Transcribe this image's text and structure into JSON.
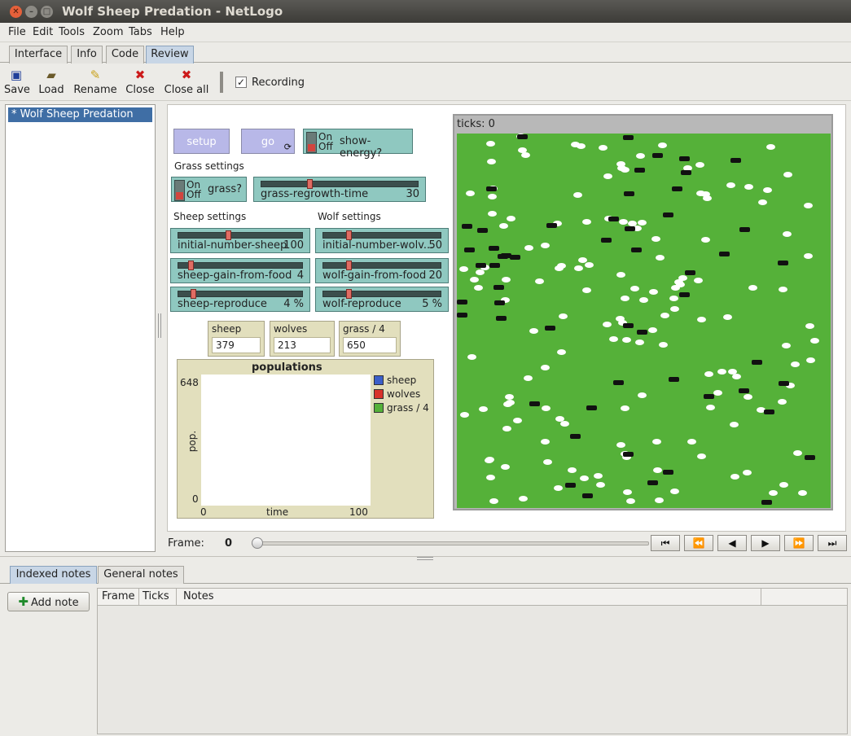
{
  "window": {
    "title": "Wolf Sheep Predation - NetLogo"
  },
  "menu": [
    "File",
    "Edit",
    "Tools",
    "Zoom",
    "Tabs",
    "Help"
  ],
  "tabs": [
    "Interface",
    "Info",
    "Code",
    "Review"
  ],
  "toolbar": {
    "save": "Save",
    "load": "Load",
    "rename": "Rename",
    "close": "Close",
    "close_all": "Close all",
    "recording_label": "Recording",
    "recording_checked": true
  },
  "runs": {
    "items": [
      "* Wolf Sheep Predation"
    ]
  },
  "interface": {
    "setup_button": "setup",
    "go_button": "go",
    "show_energy": {
      "on": "On",
      "off": "Off",
      "label": "show-energy?"
    },
    "grass_settings_note": "Grass settings",
    "grass_switch": {
      "on": "On",
      "off": "Off",
      "label": "grass?"
    },
    "grass_regrowth": {
      "label": "grass-regrowth-time",
      "value": "30",
      "fraction": 0.3
    },
    "sheep_settings_note": "Sheep settings",
    "wolf_settings_note": "Wolf settings",
    "initial_sheep": {
      "label": "initial-number-sheep",
      "value": "100",
      "fraction": 0.4
    },
    "initial_wolves": {
      "label": "initial-number-wolv...",
      "value": "50",
      "fraction": 0.2
    },
    "sheep_gain": {
      "label": "sheep-gain-from-food",
      "value": "4",
      "fraction": 0.08
    },
    "wolf_gain": {
      "label": "wolf-gain-from-food",
      "value": "20",
      "fraction": 0.2
    },
    "sheep_reproduce": {
      "label": "sheep-reproduce",
      "value": "4 %",
      "fraction": 0.1
    },
    "wolf_reproduce": {
      "label": "wolf-reproduce",
      "value": "5 %",
      "fraction": 0.2
    },
    "monitors": {
      "sheep": {
        "label": "sheep",
        "value": "379"
      },
      "wolves": {
        "label": "wolves",
        "value": "213"
      },
      "grass": {
        "label": "grass / 4",
        "value": "650"
      }
    },
    "plot": {
      "title": "populations",
      "ylabel": "pop.",
      "xlabel": "time",
      "ymax": "648",
      "ymin": "0",
      "xmin": "0",
      "xmax": "100",
      "legend": [
        {
          "name": "sheep",
          "color": "#3b5fc9"
        },
        {
          "name": "wolves",
          "color": "#d8322b"
        },
        {
          "name": "grass / 4",
          "color": "#55b139"
        }
      ]
    },
    "view": {
      "ticks_label": "ticks: 0"
    }
  },
  "frame": {
    "label": "Frame:",
    "value": "0"
  },
  "playback": {
    "first": "⏮",
    "rewind": "⏪",
    "back": "◀",
    "forward": "▶",
    "fast_forward": "⏩",
    "last": "⏭"
  },
  "notes": {
    "tabs": [
      "Indexed notes",
      "General notes"
    ],
    "add_note": "Add note",
    "columns": [
      "Frame",
      "Ticks",
      "Notes"
    ]
  }
}
